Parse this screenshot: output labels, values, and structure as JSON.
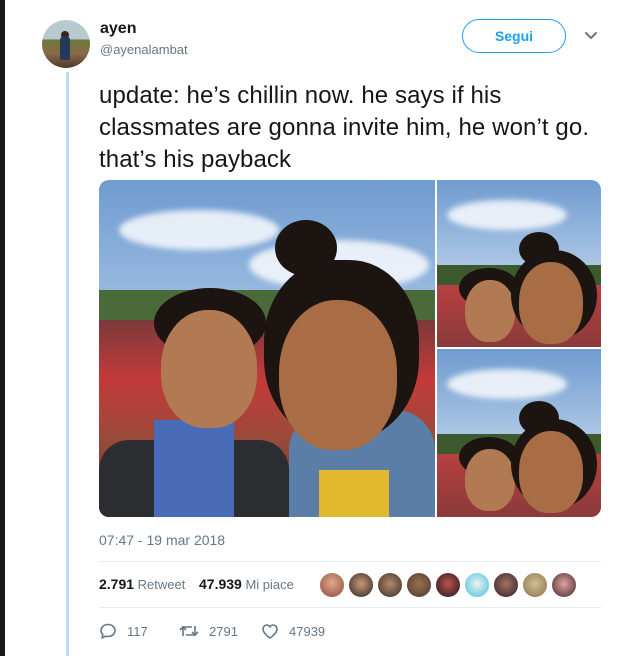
{
  "user": {
    "display_name": "ayen",
    "handle": "@ayenalambat",
    "avatar_icon": "avatar-photo"
  },
  "follow_button": {
    "label": "Segui"
  },
  "menu": {
    "icon": "chevron-down-icon"
  },
  "tweet": {
    "text": "update: he’s chillin now. he says if his classmates are gonna invite him, he won’t go. that’s his payback",
    "timestamp": "07:47 - 19 mar 2018"
  },
  "stats": {
    "retweets": "2.791",
    "retweets_label": "Retweet",
    "likes": "47.939",
    "likes_label": "Mi piace"
  },
  "actions": {
    "reply_count": "117",
    "retweet_count": "2791",
    "like_count": "47939"
  },
  "colors": {
    "accent": "#1da1f2",
    "thread": "#b9dbf2",
    "muted": "#657786"
  }
}
